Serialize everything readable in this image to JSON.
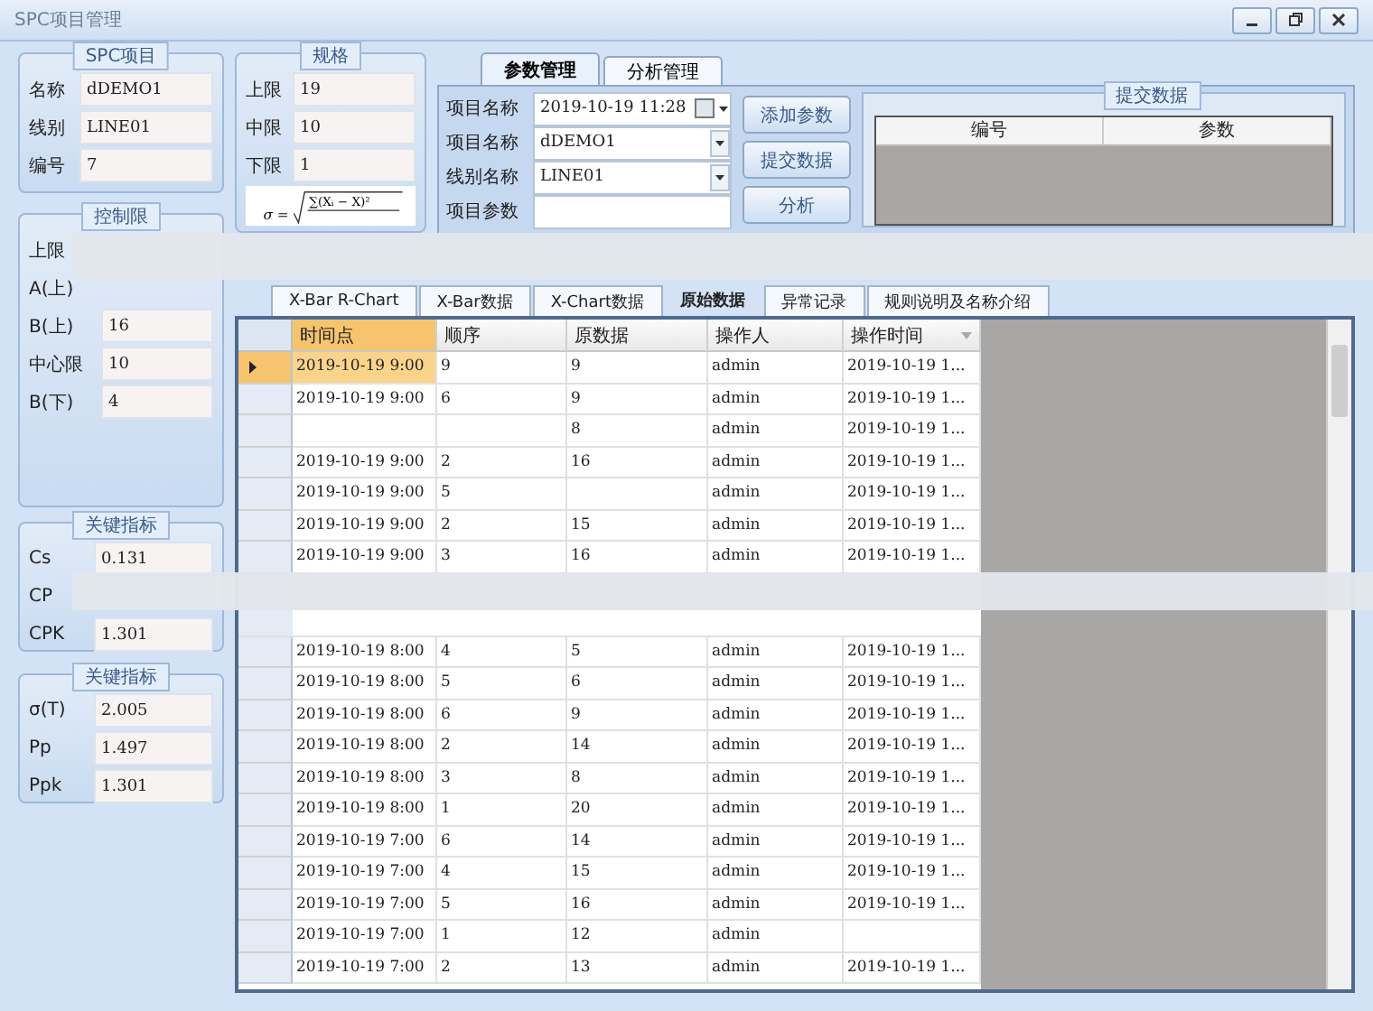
{
  "window": {
    "title": "SPC项目管理"
  },
  "spc_project": {
    "title": "SPC项目",
    "fields": [
      {
        "label": "名称",
        "value": "dDEMO1"
      },
      {
        "label": "线别",
        "value": "LINE01"
      },
      {
        "label": "编号",
        "value": "7"
      }
    ]
  },
  "control_limits": {
    "title": "控制限",
    "fields": [
      {
        "label": "上限"
      },
      {
        "label": "A(上)"
      },
      {
        "label": "B(上)",
        "value": "16"
      },
      {
        "label": "中心限",
        "value": "10"
      },
      {
        "label": "B(下)",
        "value": "4"
      }
    ]
  },
  "key_indicators": [
    {
      "title": "关键指标",
      "fields": [
        {
          "label": "Cs",
          "value": "0.131"
        },
        {
          "label": "CP"
        },
        {
          "label": "CPK",
          "value": "1.301"
        }
      ]
    },
    {
      "title": "关键指标",
      "fields": [
        {
          "label": "σ(T)",
          "value": "2.005"
        },
        {
          "label": "Pp",
          "value": "1.497"
        },
        {
          "label": "Ppk",
          "value": "1.301"
        }
      ]
    }
  ],
  "spec": {
    "title": "规格",
    "fields": [
      {
        "label": "上限",
        "value": "19"
      },
      {
        "label": "中限",
        "value": "10"
      },
      {
        "label": "下限",
        "value": "1"
      }
    ],
    "formula": {
      "lhs": "σ =",
      "numerator": "∑(Xᵢ − X)²"
    }
  },
  "top_tabs": [
    {
      "label": "参数管理",
      "selected": true
    },
    {
      "label": "分析管理",
      "selected": false
    }
  ],
  "param_form": [
    {
      "label": "项目名称",
      "value": "2019-10-19 11:28",
      "kind": "datetime"
    },
    {
      "label": "项目名称",
      "value": "dDEMO1",
      "kind": "combo"
    },
    {
      "label": "线别名称",
      "value": "LINE01",
      "kind": "combo"
    },
    {
      "label": "项目参数",
      "kind": "text"
    }
  ],
  "buttons": [
    "添加参数",
    "提交数据",
    "分析"
  ],
  "submit_panel": {
    "title": "提交数据",
    "columns": [
      "编号",
      "参数"
    ]
  },
  "grid_tabs": [
    {
      "label": "X-Bar R-Chart",
      "selected": false
    },
    {
      "label": "X-Bar数据",
      "selected": false
    },
    {
      "label": "X-Chart数据",
      "selected": false
    },
    {
      "label": "原始数据",
      "selected": true
    },
    {
      "label": "异常记录",
      "selected": false
    },
    {
      "label": "规则说明及名称介绍",
      "selected": false
    }
  ],
  "table": {
    "columns": [
      "时间点",
      "顺序",
      "原数据",
      "操作人",
      "操作时间"
    ],
    "rows": [
      {
        "kind": "data",
        "selected": true,
        "cells": [
          "2019-10-19 9:00",
          "9",
          "9",
          "admin",
          "2019-10-19 1..."
        ]
      },
      {
        "kind": "data",
        "selected": false,
        "cells": [
          "2019-10-19 9:00",
          "6",
          "9",
          "admin",
          "2019-10-19 1..."
        ]
      },
      {
        "kind": "data",
        "selected": false,
        "cells": [
          "",
          "",
          "8",
          "admin",
          "2019-10-19 1..."
        ]
      },
      {
        "kind": "data",
        "selected": false,
        "cells": [
          "2019-10-19 9:00",
          "2",
          "16",
          "admin",
          "2019-10-19 1..."
        ]
      },
      {
        "kind": "data",
        "selected": false,
        "cells": [
          "2019-10-19 9:00",
          "5",
          "",
          "admin",
          "2019-10-19 1..."
        ]
      },
      {
        "kind": "data",
        "selected": false,
        "cells": [
          "2019-10-19 9:00",
          "2",
          "15",
          "admin",
          "2019-10-19 1..."
        ]
      },
      {
        "kind": "data",
        "selected": false,
        "cells": [
          "2019-10-19 9:00",
          "3",
          "16",
          "admin",
          "2019-10-19 1..."
        ]
      },
      {
        "kind": "obscured"
      },
      {
        "kind": "data",
        "selected": false,
        "cells": [
          "2019-10-19 8:00",
          "4",
          "5",
          "admin",
          "2019-10-19 1..."
        ]
      },
      {
        "kind": "data",
        "selected": false,
        "cells": [
          "2019-10-19 8:00",
          "5",
          "6",
          "admin",
          "2019-10-19 1..."
        ]
      },
      {
        "kind": "data",
        "selected": false,
        "cells": [
          "2019-10-19 8:00",
          "6",
          "9",
          "admin",
          "2019-10-19 1..."
        ]
      },
      {
        "kind": "data",
        "selected": false,
        "cells": [
          "2019-10-19 8:00",
          "2",
          "14",
          "admin",
          "2019-10-19 1..."
        ]
      },
      {
        "kind": "data",
        "selected": false,
        "cells": [
          "2019-10-19 8:00",
          "3",
          "8",
          "admin",
          "2019-10-19 1..."
        ]
      },
      {
        "kind": "data",
        "selected": false,
        "cells": [
          "2019-10-19 8:00",
          "1",
          "20",
          "admin",
          "2019-10-19 1..."
        ]
      },
      {
        "kind": "data",
        "selected": false,
        "cells": [
          "2019-10-19 7:00",
          "6",
          "14",
          "admin",
          "2019-10-19 1..."
        ]
      },
      {
        "kind": "data",
        "selected": false,
        "cells": [
          "2019-10-19 7:00",
          "4",
          "15",
          "admin",
          "2019-10-19 1..."
        ]
      },
      {
        "kind": "data",
        "selected": false,
        "cells": [
          "2019-10-19 7:00",
          "5",
          "16",
          "admin",
          "2019-10-19 1..."
        ]
      },
      {
        "kind": "data",
        "selected": false,
        "cells": [
          "2019-10-19 7:00",
          "1",
          "12",
          "admin",
          ""
        ]
      },
      {
        "kind": "data",
        "selected": false,
        "cells": [
          "2019-10-19 7:00",
          "2",
          "13",
          "admin",
          "2019-10-19 1..."
        ]
      }
    ]
  }
}
